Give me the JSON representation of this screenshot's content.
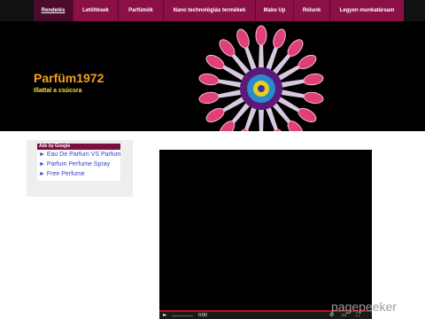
{
  "nav": {
    "items": [
      {
        "label": "Rendelés",
        "active": true
      },
      {
        "label": "Letöltések"
      },
      {
        "label": "Parfümök"
      },
      {
        "label": "Nano technológiás termékek"
      },
      {
        "label": "Make Up"
      },
      {
        "label": "Rólunk"
      },
      {
        "label": "Legyen munkatársam"
      }
    ]
  },
  "header": {
    "title": "Parfüm1972",
    "subtitle": "Illattal a csúcsra"
  },
  "ads": {
    "header": "Ads by Google",
    "links": [
      "► Eau De Parfum VS Parfum",
      "► Parfum Perfume Spray",
      "► Free Perfume"
    ]
  },
  "video": {
    "time": "0:00"
  },
  "watermark": {
    "text": "pagepeeker"
  },
  "colors": {
    "nav_bg": "#8b1045",
    "nav_active": "#4a0c2a",
    "title": "#f0a020",
    "subtitle": "#f2e23a",
    "ad_link": "#3344cc",
    "progress": "#cc1010"
  }
}
